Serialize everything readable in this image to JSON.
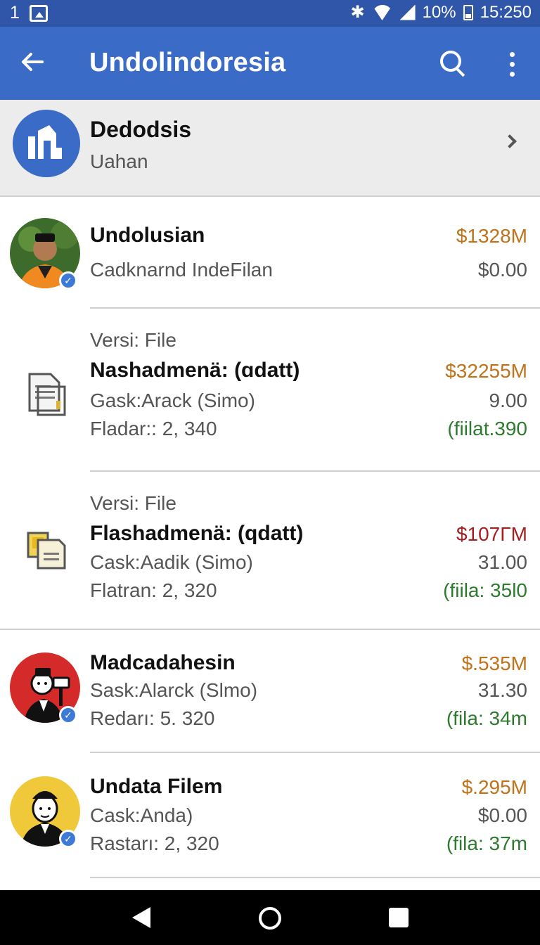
{
  "status": {
    "notif_count": "1",
    "battery": "10%",
    "time": "15:250"
  },
  "appbar": {
    "title": "Undolindoresia"
  },
  "account": {
    "name": "Dedodsis",
    "subtitle": "Uahan"
  },
  "items": [
    {
      "type": "person",
      "title": "Undolusian",
      "lines": [
        "Cadknarnd IndeFilan"
      ],
      "amounts": [
        "$1328M",
        "$0.00"
      ]
    },
    {
      "type": "file",
      "header": "Versi: File",
      "title": "Nashadmenä: (ɑdatt)",
      "lines": [
        "Gask:Arack (Simo)",
        "Fladar:: 2, 340"
      ],
      "amounts": [
        "$32255M",
        "9.00",
        "(fiilat.390"
      ]
    },
    {
      "type": "file",
      "header": "Versi: File",
      "title": "Flashadmenä: (qdatt)",
      "lines": [
        "Cask:Aadik (Simo)",
        "Flatran: 2, 320"
      ],
      "amounts": [
        "$107ΓM",
        "31.00",
        "(fiila: 35l0"
      ]
    },
    {
      "type": "person",
      "title": "Madcadahesin",
      "lines": [
        "Sask:Alarck (Slmo)",
        "Redarı: 5. 320"
      ],
      "amounts": [
        "$.535M",
        "31.30",
        "(fila: 34m"
      ]
    },
    {
      "type": "person",
      "title": "Undata Filem",
      "lines": [
        "Cask:Anda)",
        "Rastarı: 2, 320"
      ],
      "amounts": [
        "$.295M",
        "$0.00",
        "(fila: 37m"
      ]
    }
  ],
  "colors": {
    "appbar": "#3a6bc6",
    "statusbar": "#2f56a8",
    "orange": "#c0721a",
    "red": "#a32020",
    "green": "#2e7a2e"
  }
}
